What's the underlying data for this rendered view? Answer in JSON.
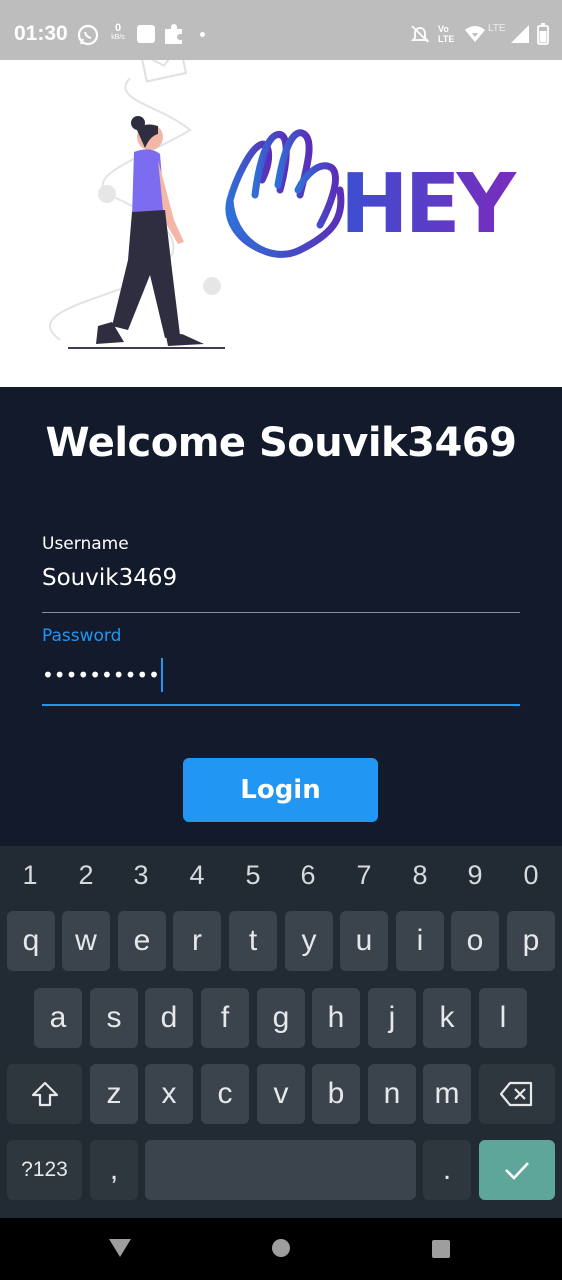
{
  "status_bar": {
    "time": "01:30",
    "net_speed_value": "0",
    "net_speed_unit": "kB/s",
    "lte_label": "LTE",
    "volte_top": "Vo",
    "volte_bottom": "LTE"
  },
  "hero": {
    "logo_text": "HEY",
    "colors": {
      "hand_start": "#2f6fd8",
      "hand_end": "#5a2fb8",
      "logo_start": "#3b4fd0",
      "logo_end": "#7a2bbd"
    }
  },
  "login": {
    "welcome": "Welcome Souvik3469",
    "username_label": "Username",
    "username_value": "Souvik3469",
    "password_label": "Password",
    "password_value": "••••••••••",
    "login_button": "Login",
    "colors": {
      "accent": "#2196f3",
      "background": "#121a2b"
    }
  },
  "keyboard": {
    "number_row": [
      "1",
      "2",
      "3",
      "4",
      "5",
      "6",
      "7",
      "8",
      "9",
      "0"
    ],
    "row1": [
      "q",
      "w",
      "e",
      "r",
      "t",
      "y",
      "u",
      "i",
      "o",
      "p"
    ],
    "row2": [
      "a",
      "s",
      "d",
      "f",
      "g",
      "h",
      "j",
      "k",
      "l"
    ],
    "row3": [
      "z",
      "x",
      "c",
      "v",
      "b",
      "n",
      "m"
    ],
    "symbols_key": "?123",
    "comma_key": ",",
    "period_key": ".",
    "shift_icon": "shift-icon",
    "backspace_icon": "backspace-icon",
    "enter_icon": "check-icon"
  },
  "navbar": {
    "icons": [
      "back-icon",
      "home-icon",
      "recents-icon"
    ]
  }
}
